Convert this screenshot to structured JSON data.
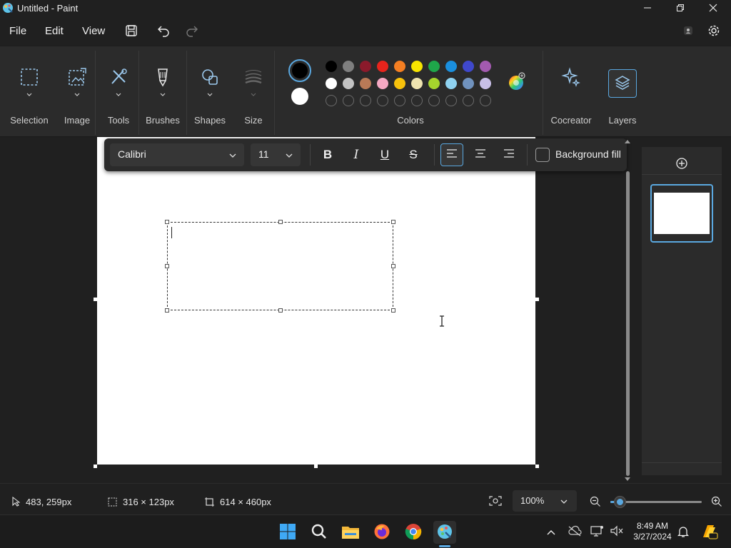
{
  "window": {
    "title": "Untitled - Paint",
    "app_icon": "paint-icon",
    "minimize_icon": "minimize-icon",
    "restore_icon": "restore-icon",
    "close_icon": "close-icon"
  },
  "menu": {
    "file": "File",
    "edit": "Edit",
    "view": "View",
    "icons": [
      "save-icon",
      "undo-icon",
      "redo-icon",
      "account-icon",
      "settings-icon"
    ]
  },
  "ribbon": {
    "groups": [
      {
        "label": "Selection",
        "icon": "selection-icon"
      },
      {
        "label": "Image",
        "icon": "image-icon"
      },
      {
        "label": "Tools",
        "icon": "tools-icon"
      },
      {
        "label": "Brushes",
        "icon": "brush-icon"
      },
      {
        "label": "Shapes",
        "icon": "shapes-icon"
      },
      {
        "label": "Size",
        "icon": "size-icon"
      },
      {
        "label": "Colors",
        "icon": "palette-icon"
      },
      {
        "label": "Cocreator",
        "icon": "sparkle-icon"
      },
      {
        "label": "Layers",
        "icon": "layers-icon"
      }
    ],
    "primary_color": "#000000",
    "secondary_color": "#ffffff",
    "palette_row1": [
      "#000000",
      "#7f7f7f",
      "#8b1a2b",
      "#e8241c",
      "#f57f22",
      "#f7e400",
      "#1fa64a",
      "#1a8fde",
      "#3f48cc",
      "#a35ab0"
    ],
    "palette_row2": [
      "#ffffff",
      "#c3c3c3",
      "#b97a57",
      "#f5a9c3",
      "#f7c20c",
      "#efe4b0",
      "#a6d52d",
      "#8fd2f0",
      "#7092be",
      "#c8bfe7"
    ],
    "accent": "#5aa8e0"
  },
  "text_toolbar": {
    "font": "Calibri",
    "size": "11",
    "bold": "B",
    "italic": "I",
    "underline": "U",
    "strike": "S",
    "background_fill": "Background fill",
    "align_icons": [
      "align-left-icon",
      "align-center-icon",
      "align-right-icon"
    ]
  },
  "layers": {
    "add_icon": "add-layer-icon"
  },
  "status": {
    "cursor_pos": "483, 259px",
    "selection_size": "316 × 123px",
    "canvas_size": "614 × 460px",
    "zoom": "100%",
    "zoom_level": 0.1
  },
  "taskbar": {
    "apps": [
      "windows-start-icon",
      "search-icon",
      "file-explorer-icon",
      "firefox-icon",
      "chrome-icon",
      "paint-icon"
    ],
    "time": "8:49 AM",
    "date": "3/27/2024"
  }
}
